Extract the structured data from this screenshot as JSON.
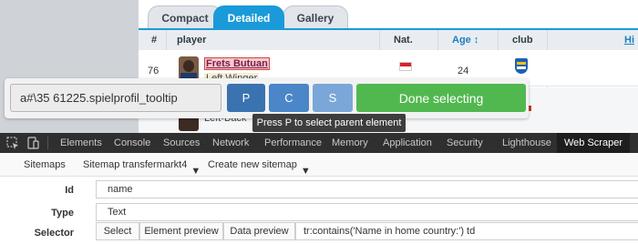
{
  "webpage": {
    "tabs": [
      "Compact",
      "Detailed",
      "Gallery"
    ],
    "active_tab": "Detailed",
    "columns": {
      "number": "#",
      "player": "player",
      "nat": "Nat.",
      "age": "Age",
      "club": "club",
      "more": "Hi"
    },
    "rows": [
      {
        "number": "76",
        "name": "Frets Butuan",
        "position": "Left Winger",
        "age": "24"
      },
      {
        "position": "Left-Back"
      }
    ]
  },
  "selector_toolbar": {
    "selector_value": "a#\\35 61225.spielprofil_tooltip",
    "parent_button": "P",
    "child_button": "C",
    "scroll_button": "S",
    "done_button": "Done selecting",
    "tooltip": "Press P to select parent element"
  },
  "devtools": {
    "tabs": [
      "Elements",
      "Console",
      "Sources",
      "Network",
      "Performance",
      "Memory",
      "Application",
      "Security",
      "Lighthouse",
      "Web Scraper"
    ],
    "active_tab": "Web Scraper"
  },
  "scraper": {
    "nav": {
      "sitemaps": "Sitemaps",
      "current_sitemap": "Sitemap transfermarkt4",
      "create": "Create new sitemap"
    },
    "fields": {
      "id_label": "Id",
      "id_value": "name",
      "type_label": "Type",
      "type_value": "Text",
      "selector_label": "Selector",
      "select_button": "Select",
      "element_preview_button": "Element preview",
      "data_preview_button": "Data preview",
      "selector_value": "tr:contains('Name in home country:') td"
    }
  },
  "colors": {
    "accent_blue": "#1a9ad8",
    "done_green": "#51b84f",
    "devtools_dark": "#2f2f2f"
  }
}
